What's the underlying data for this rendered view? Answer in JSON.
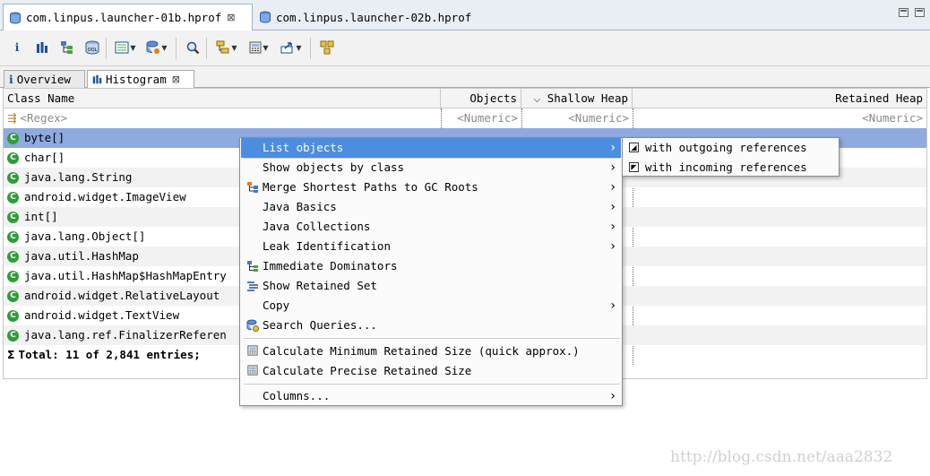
{
  "editor_tabs": [
    {
      "label": "com.linpus.launcher-01b.hprof",
      "active": true
    },
    {
      "label": "com.linpus.launcher-02b.hprof",
      "active": false
    }
  ],
  "inner_tabs": [
    {
      "label": "Overview",
      "active": false
    },
    {
      "label": "Histogram",
      "active": true
    }
  ],
  "columns": {
    "class_name": "Class Name",
    "objects": "Objects",
    "shallow_heap": "Shallow Heap",
    "retained_heap": "Retained Heap"
  },
  "filter_row": {
    "class_name": "<Regex>",
    "objects": "<Numeric>",
    "shallow_heap": "<Numeric>",
    "retained_heap": "<Numeric>"
  },
  "rows": [
    {
      "class_name": "byte[]",
      "selected": true
    },
    {
      "class_name": "char[]"
    },
    {
      "class_name": "java.lang.String"
    },
    {
      "class_name": "android.widget.ImageView"
    },
    {
      "class_name": "int[]"
    },
    {
      "class_name": "java.lang.Object[]"
    },
    {
      "class_name": "java.util.HashMap"
    },
    {
      "class_name": "java.util.HashMap$HashMapEntry"
    },
    {
      "class_name": "android.widget.RelativeLayout"
    },
    {
      "class_name": "android.widget.TextView"
    },
    {
      "class_name": "java.lang.ref.FinalizerReferen"
    }
  ],
  "total_row": "Total: 11 of 2,841 entries;",
  "context_menu": {
    "items": [
      {
        "label": "List objects",
        "submenu": true,
        "highlighted": true
      },
      {
        "label": "Show objects by class",
        "submenu": true
      },
      {
        "label": "Merge Shortest Paths to GC Roots",
        "submenu": true,
        "icon": "merge-paths-icon"
      },
      {
        "label": "Java Basics",
        "submenu": true
      },
      {
        "label": "Java Collections",
        "submenu": true
      },
      {
        "label": "Leak Identification",
        "submenu": true
      },
      {
        "label": "Immediate Dominators",
        "icon": "dominators-icon"
      },
      {
        "label": "Show Retained Set",
        "icon": "retained-set-icon"
      },
      {
        "label": "Copy",
        "submenu": true
      },
      {
        "label": "Search Queries...",
        "icon": "search-queries-icon"
      },
      {
        "label": "Calculate Minimum Retained Size (quick approx.)",
        "icon": "calculator-icon"
      },
      {
        "label": "Calculate Precise Retained Size",
        "icon": "calculator-icon"
      },
      {
        "label": "Columns...",
        "submenu": true
      }
    ]
  },
  "submenu": {
    "items": [
      {
        "label": "with outgoing references",
        "icon": "outgoing-references-icon"
      },
      {
        "label": "with incoming references",
        "icon": "incoming-references-icon"
      }
    ]
  },
  "watermark": "http://blog.csdn.net/aaa2832",
  "colors": {
    "selection": "#8eaadf",
    "menu_highlight": "#4d8de0",
    "class_icon": "#2f9c3a"
  }
}
